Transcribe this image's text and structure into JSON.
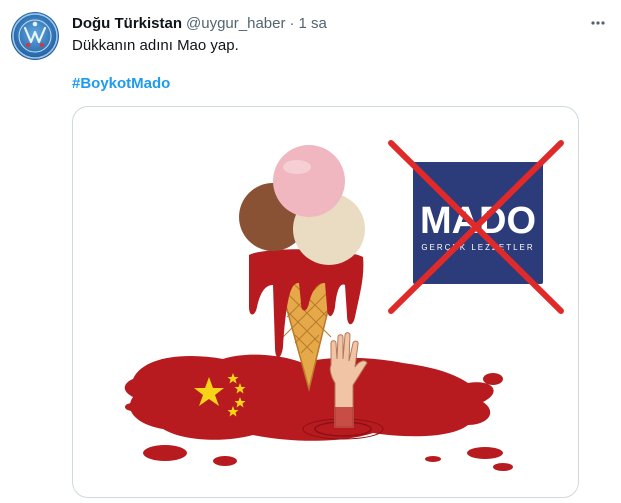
{
  "tweet": {
    "display_name": "Doğu Türkistan",
    "handle": "@uygur_haber",
    "separator": "·",
    "time": "1 sa",
    "text": "Dükkanın adını Mao yap.",
    "hashtag": "#BoykotMado"
  },
  "image": {
    "logo_text": "MADO",
    "logo_tagline": "GERÇEK LEZZETLER",
    "logo_bg": "#2c3b7a",
    "cross_color": "#e02a2a",
    "blood_color": "#b71b1f",
    "star_color": "#f7d417"
  },
  "icons": {
    "more": "more-horizontal-icon",
    "avatar": "avatar-image"
  }
}
